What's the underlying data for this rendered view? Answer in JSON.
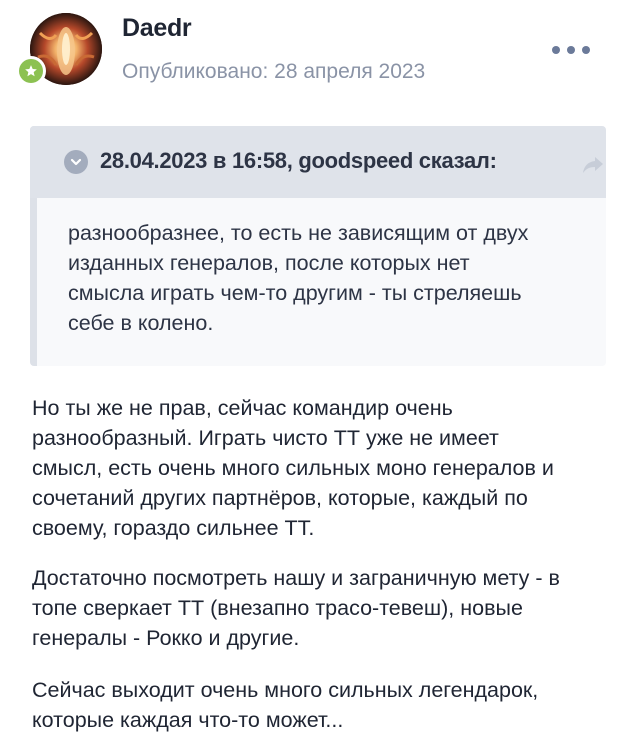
{
  "post": {
    "author": "Daedr",
    "published": "Опубликовано: 28 апреля 2023",
    "icons": {
      "more": "more-horizontal-icon",
      "badge": "star-icon",
      "quote_toggle": "chevron-down-icon",
      "quote_share": "share-arrow-icon"
    },
    "quote": {
      "citation": "28.04.2023 в 16:58, goodspeed сказал:",
      "lines": [
        "разнообразнее, то есть не зависящим от двух",
        "изданных генералов, после которых нет",
        "смысла играть чем-то другим - ты стреляешь",
        "себе в колено."
      ]
    },
    "paragraphs": [
      {
        "lines": [
          "Но ты же не прав, сейчас командир очень",
          "разнообразный. Играть чисто ТТ уже не имеет",
          "смысл, есть очень много сильных моно генералов и",
          "сочетаний других партнёров, которые, каждый по",
          "своему, гораздо сильнее ТТ."
        ]
      },
      {
        "lines": [
          "Достаточно посмотреть нашу и заграничную мету - в",
          "топе сверкает ТТ (внезапно трасо-тевеш), новые",
          "генералы - Рокко и другие."
        ]
      },
      {
        "lines": [
          "Сейчас выходит очень много сильных легендарок,",
          "которые каждая что-то может..."
        ]
      }
    ]
  },
  "colors": {
    "background": "#ffffff",
    "text": "#1f2533",
    "muted": "#8a93a6",
    "quote_header": "#dfe3ea",
    "quote_body": "#f8f9fb",
    "badge": "#8cc152"
  }
}
